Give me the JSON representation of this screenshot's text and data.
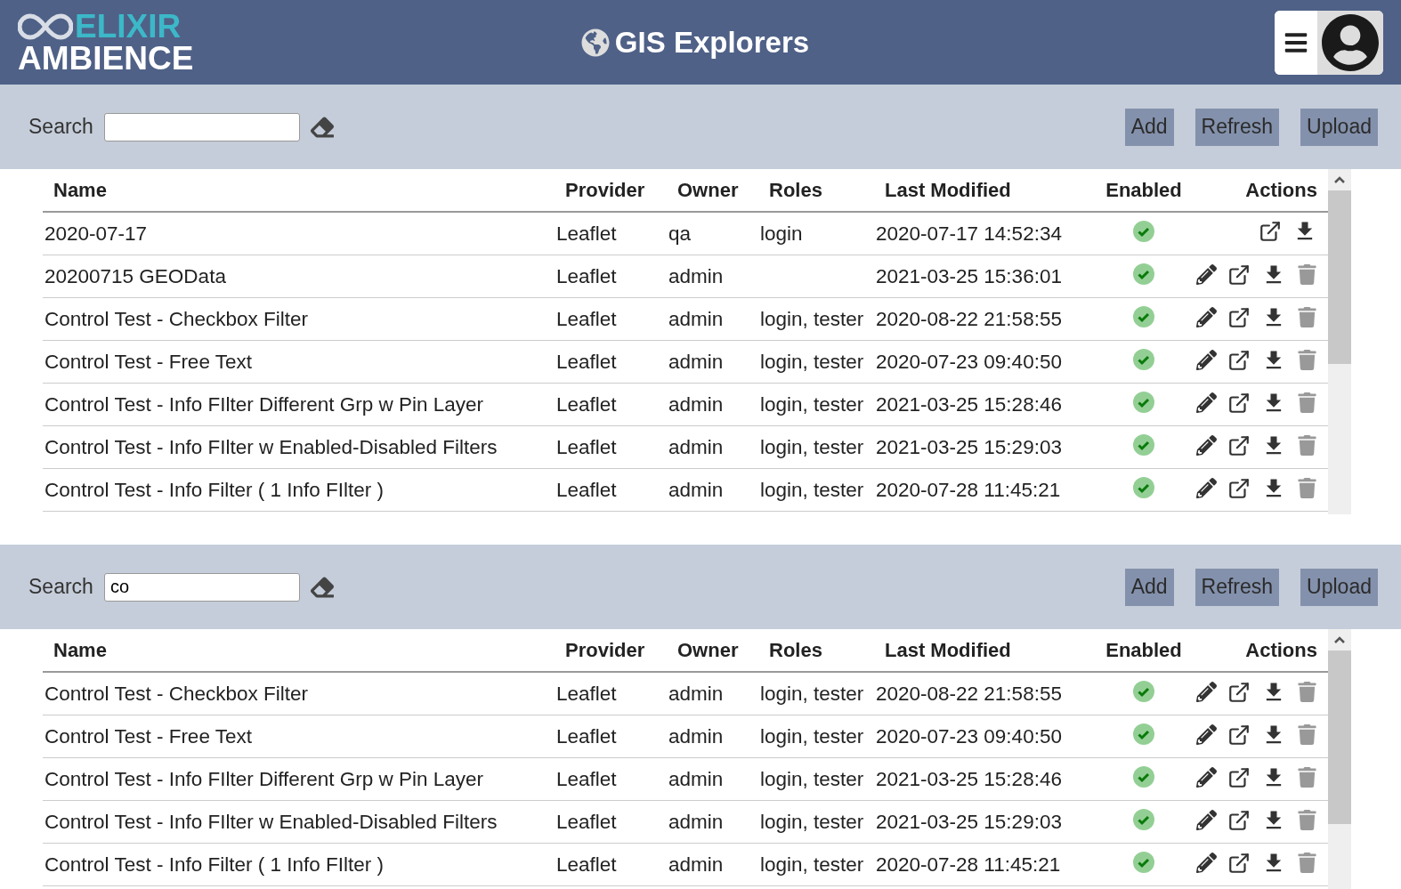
{
  "header": {
    "logo_top": "ELIXIR",
    "logo_bottom": "AMBIENCE",
    "title": "GIS Explorers"
  },
  "panels": [
    {
      "search": {
        "label": "Search"
      },
      "buttons": [
        "Add",
        "Refresh",
        "Upload"
      ],
      "columns": [
        "Name",
        "Provider",
        "Owner",
        "Roles",
        "Last Modified",
        "Enabled",
        "Actions"
      ],
      "rows": [
        {
          "name": "2020-07-17",
          "provider": "Leaflet",
          "owner": "qa",
          "roles": "login",
          "last_modified": "2020-07-17 14:52:34",
          "enabled": true,
          "can_edit": false,
          "can_delete": false
        },
        {
          "name": "20200715 GEOData",
          "provider": "Leaflet",
          "owner": "admin",
          "last_modified": "2021-03-25 15:36:01",
          "enabled": true,
          "can_edit": true,
          "can_delete": true
        },
        {
          "name": "Control Test - Checkbox Filter",
          "provider": "Leaflet",
          "owner": "admin",
          "roles": "login, tester",
          "last_modified": "2020-08-22 21:58:55",
          "enabled": true,
          "can_edit": true,
          "can_delete": true
        },
        {
          "name": "Control Test - Free Text",
          "provider": "Leaflet",
          "owner": "admin",
          "roles": "login, tester",
          "last_modified": "2020-07-23 09:40:50",
          "enabled": true,
          "can_edit": true,
          "can_delete": true
        },
        {
          "name": "Control Test - Info FIlter Different Grp w Pin Layer",
          "provider": "Leaflet",
          "owner": "admin",
          "roles": "login, tester",
          "last_modified": "2021-03-25 15:28:46",
          "enabled": true,
          "can_edit": true,
          "can_delete": true
        },
        {
          "name": "Control Test - Info FIlter w Enabled-Disabled Filters",
          "provider": "Leaflet",
          "owner": "admin",
          "roles": "login, tester",
          "last_modified": "2021-03-25 15:29:03",
          "enabled": true,
          "can_edit": true,
          "can_delete": true
        },
        {
          "name": "Control Test - Info Filter ( 1 Info FIlter )",
          "provider": "Leaflet",
          "owner": "admin",
          "roles": "login, tester",
          "last_modified": "2020-07-28 11:45:21",
          "enabled": true,
          "can_edit": true,
          "can_delete": true
        }
      ]
    },
    {
      "search": {
        "label": "Search",
        "value": "co"
      },
      "buttons": [
        "Add",
        "Refresh",
        "Upload"
      ],
      "columns": [
        "Name",
        "Provider",
        "Owner",
        "Roles",
        "Last Modified",
        "Enabled",
        "Actions"
      ],
      "rows": [
        {
          "name": "Control Test - Checkbox Filter",
          "provider": "Leaflet",
          "owner": "admin",
          "roles": "login, tester",
          "last_modified": "2020-08-22 21:58:55",
          "enabled": true,
          "can_edit": true,
          "can_delete": true
        },
        {
          "name": "Control Test - Free Text",
          "provider": "Leaflet",
          "owner": "admin",
          "roles": "login, tester",
          "last_modified": "2020-07-23 09:40:50",
          "enabled": true,
          "can_edit": true,
          "can_delete": true
        },
        {
          "name": "Control Test - Info FIlter Different Grp w Pin Layer",
          "provider": "Leaflet",
          "owner": "admin",
          "roles": "login, tester",
          "last_modified": "2021-03-25 15:28:46",
          "enabled": true,
          "can_edit": true,
          "can_delete": true
        },
        {
          "name": "Control Test - Info FIlter w Enabled-Disabled Filters",
          "provider": "Leaflet",
          "owner": "admin",
          "roles": "login, tester",
          "last_modified": "2021-03-25 15:29:03",
          "enabled": true,
          "can_edit": true,
          "can_delete": true
        },
        {
          "name": "Control Test - Info Filter ( 1 Info FIlter )",
          "provider": "Leaflet",
          "owner": "admin",
          "roles": "login, tester",
          "last_modified": "2020-07-28 11:45:21",
          "enabled": true,
          "can_edit": true,
          "can_delete": true
        }
      ]
    }
  ]
}
